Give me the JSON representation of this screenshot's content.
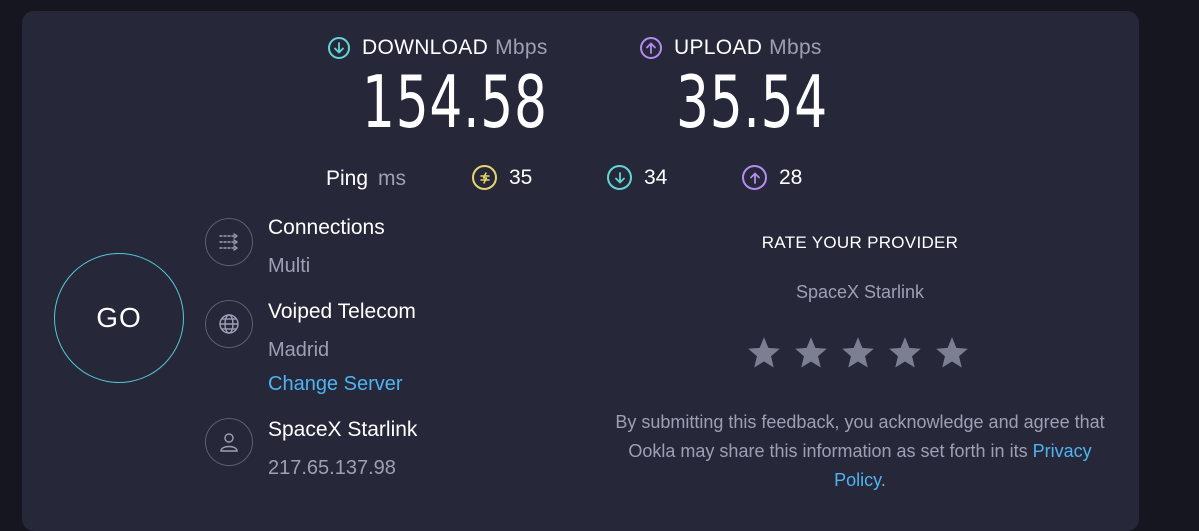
{
  "download": {
    "label": "DOWNLOAD",
    "unit": "Mbps",
    "value": "154.58",
    "icon": "download-arrow-icon",
    "color": "#62d6d6"
  },
  "upload": {
    "label": "UPLOAD",
    "unit": "Mbps",
    "value": "35.54",
    "icon": "upload-arrow-icon",
    "color": "#b58cf0"
  },
  "ping": {
    "label": "Ping",
    "unit": "ms",
    "idle": {
      "value": "35",
      "icon": "idle-latency-icon",
      "color": "#e7d56f"
    },
    "download": {
      "value": "34",
      "icon": "download-latency-icon",
      "color": "#62d6d6"
    },
    "upload": {
      "value": "28",
      "icon": "upload-latency-icon",
      "color": "#b58cf0"
    }
  },
  "go_button": {
    "label": "GO",
    "color": "#53c7d6"
  },
  "connections": {
    "title": "Connections",
    "value": "Multi",
    "icon": "connections-icon"
  },
  "server": {
    "title": "Voiped Telecom",
    "location": "Madrid",
    "change_link": "Change Server",
    "icon": "globe-icon"
  },
  "provider": {
    "title": "SpaceX Starlink",
    "ip": "217.65.137.98",
    "icon": "user-icon"
  },
  "rate": {
    "title": "RATE YOUR PROVIDER",
    "provider": "SpaceX Starlink",
    "stars": 5,
    "rating": 0,
    "disclaimer_pre": "By submitting this feedback, you acknowledge and agree that Ookla may share this information as set forth in its ",
    "privacy_link": "Privacy Policy",
    "disclaimer_post": "."
  }
}
